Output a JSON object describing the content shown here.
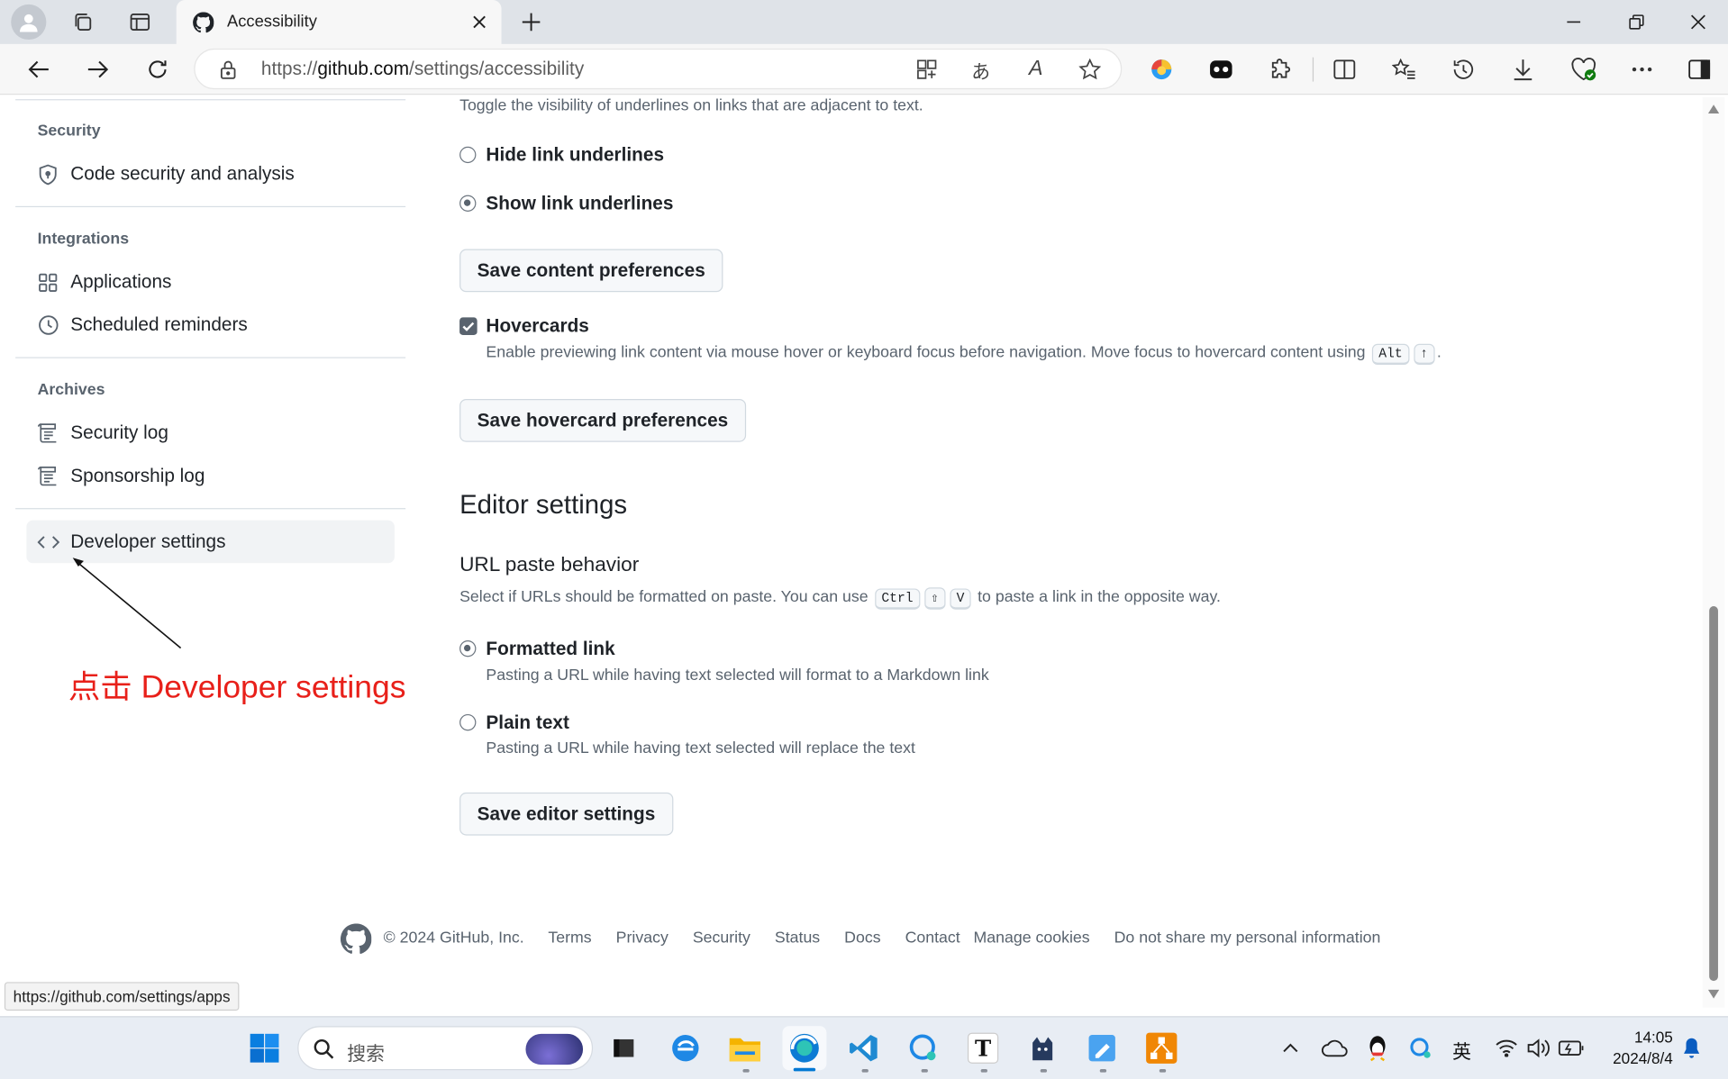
{
  "browser": {
    "tab_title": "Accessibility",
    "url_prefix": "https://",
    "url_host": "github.com",
    "url_path": "/settings/accessibility",
    "status_url": "https://github.com/settings/apps",
    "translate_glyph": "あ",
    "read_glyph": "A"
  },
  "sidebar": {
    "security_heading": "Security",
    "code_security": "Code security and analysis",
    "integrations_heading": "Integrations",
    "applications": "Applications",
    "scheduled_reminders": "Scheduled reminders",
    "archives_heading": "Archives",
    "security_log": "Security log",
    "sponsorship_log": "Sponsorship log",
    "developer_settings": "Developer settings"
  },
  "annotation": {
    "text": "点击 Developer settings",
    "color": "#e8201a"
  },
  "content": {
    "underline_desc": "Toggle the visibility of underlines on links that are adjacent to text.",
    "hide_underlines": "Hide link underlines",
    "show_underlines": "Show link underlines",
    "save_content": "Save content preferences",
    "hovercards_label": "Hovercards",
    "hovercards_desc": "Enable previewing link content via mouse hover or keyboard focus before navigation. Move focus to hovercard content using",
    "hovercards_key1": "Alt",
    "hovercards_key2": "↑",
    "hovercards_end": ".",
    "save_hovercard": "Save hovercard preferences",
    "editor_heading": "Editor settings",
    "url_paste_heading": "URL paste behavior",
    "url_paste_desc_a": "Select if URLs should be formatted on paste. You can use",
    "key_ctrl": "Ctrl",
    "key_shift": "⇧",
    "key_v": "V",
    "url_paste_desc_b": "to paste a link in the opposite way.",
    "formatted_link": "Formatted link",
    "formatted_link_desc": "Pasting a URL while having text selected will format to a Markdown link",
    "plain_text": "Plain text",
    "plain_text_desc": "Pasting a URL while having text selected will replace the text",
    "save_editor": "Save editor settings",
    "show_underlines_selected": true,
    "hovercards_checked": true,
    "formatted_link_selected": true
  },
  "footer": {
    "copyright": "© 2024 GitHub, Inc.",
    "links": [
      "Terms",
      "Privacy",
      "Security",
      "Status",
      "Docs",
      "Contact",
      "Manage cookies",
      "Do not share my personal information"
    ]
  },
  "taskbar": {
    "search_placeholder": "搜索",
    "ime": "英",
    "time": "14:05",
    "date": "2024/8/4",
    "text_app_glyph": "T"
  },
  "colors": {
    "accent_blue": "#0969da",
    "windows_blue": "#0078d4",
    "annotation_red": "#e8201a"
  }
}
